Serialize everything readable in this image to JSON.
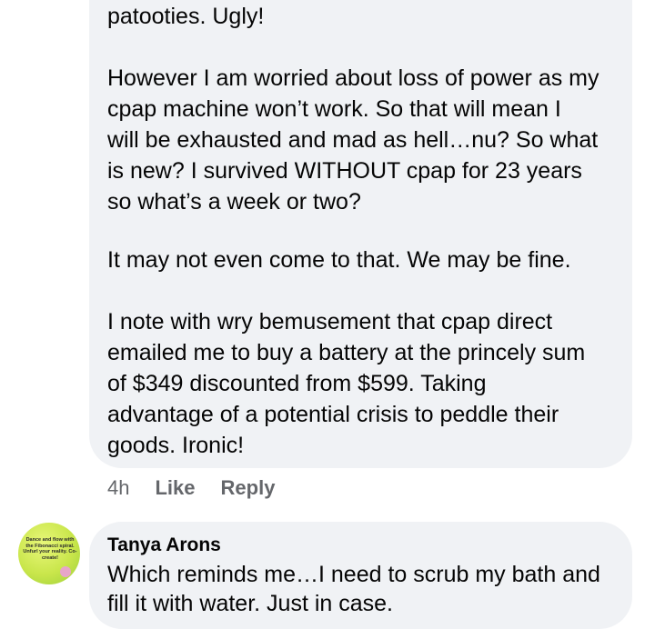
{
  "comment_top": {
    "paragraphs": [
      "patooties.  Ugly!",
      "However I am worried about loss of power as my\ncpap machine won’t work.  So that will mean I\nwill be exhausted and mad as hell…nu? So what\nis new?  I survived WITHOUT cpap for 23 years\nso what’s a week or two?",
      "It may not even come to that.  We may be fine.",
      "I note with wry bemusement that cpap direct\nemailed me to buy a battery at the princely sum\nof $349 discounted from $599.  Taking\nadvantage of a potential crisis to peddle their\ngoods. Ironic!"
    ],
    "time": "4h",
    "like_label": "Like",
    "reply_label": "Reply"
  },
  "comment_bottom": {
    "author": "Tanya Arons",
    "text": "Which reminds me…I need to scrub my bath and fill it with water. Just in case.",
    "avatar_text": "Dance and flow with the Fibonacci spiral. Unfurl your reality. Co-create!"
  },
  "colors": {
    "bubble": "#f0f2f5",
    "secondary_text": "#65676b",
    "primary_text": "#050505"
  }
}
